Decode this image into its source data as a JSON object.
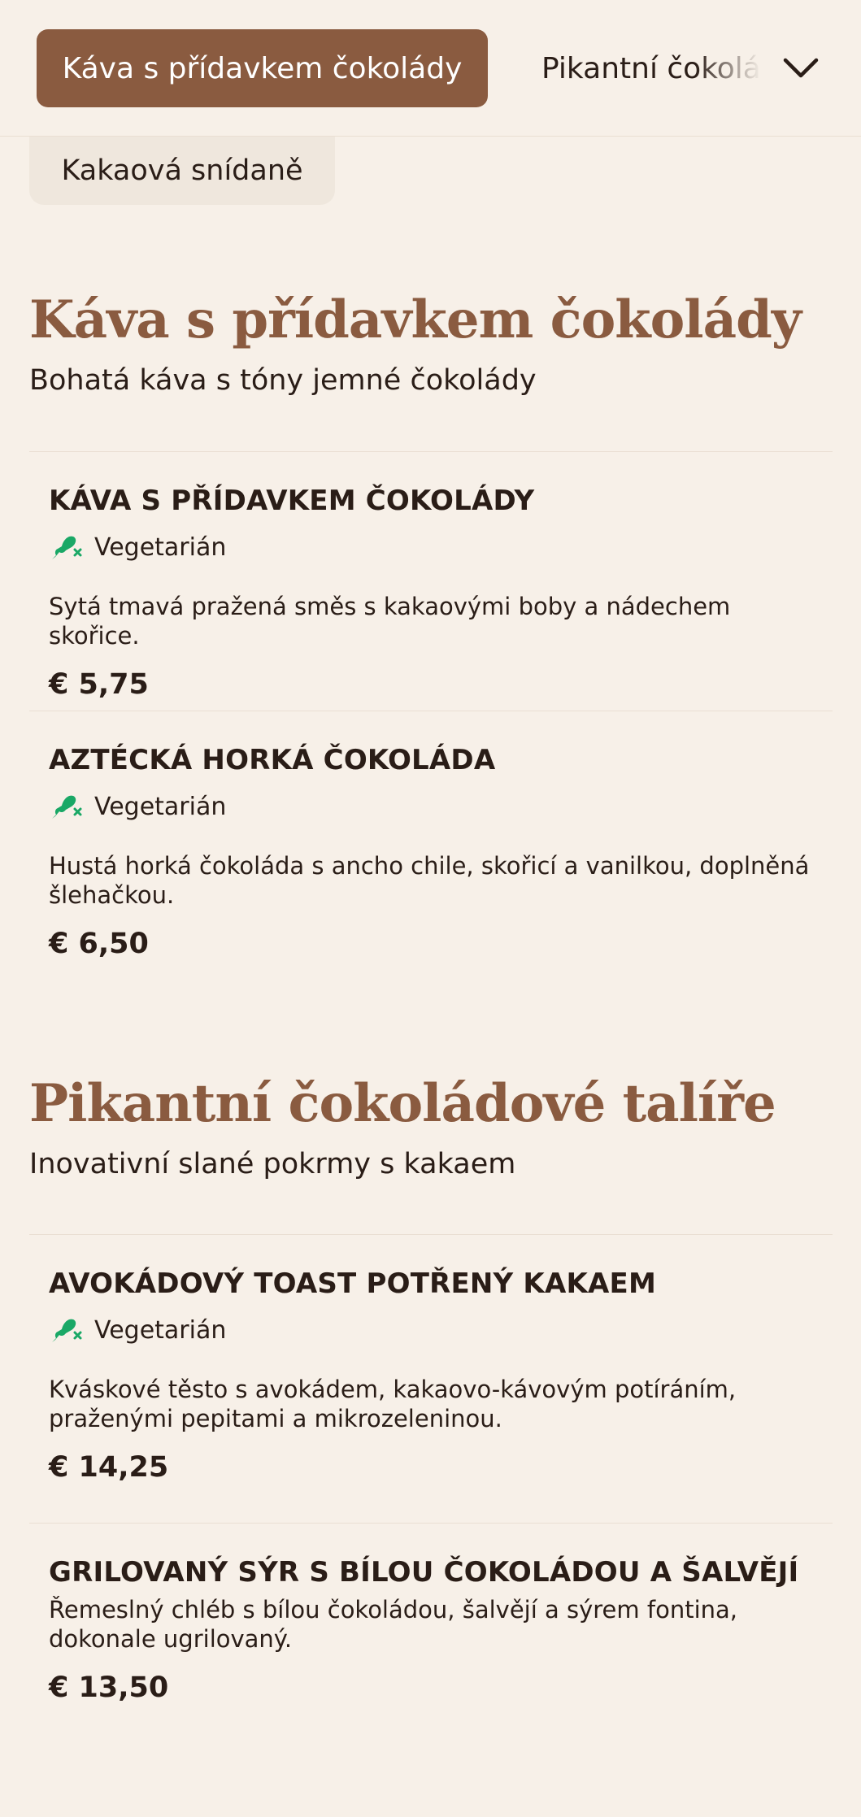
{
  "nav": {
    "active_tab": "Káva s přídavkem čokolády",
    "next_tab": "Pikantní čokoládové talíře",
    "second_row_tab": "Kakaová snídaně",
    "chevron_icon": "chevron-down-icon"
  },
  "colors": {
    "accent": "#8a5b40",
    "background": "#f7f0e8",
    "vegetarian_icon": "#1aa866"
  },
  "sections": [
    {
      "title": "Káva s přídavkem čokolády",
      "description": "Bohatá káva s tóny jemné čokolády",
      "items": [
        {
          "name": "KÁVA S PŘÍDAVKEM ČOKOLÁDY",
          "badge": "Vegetarián",
          "description": "Sytá tmavá pražená směs s kakaovými boby a nádechem skořice.",
          "price": "€ 5,75"
        },
        {
          "name": "AZTÉCKÁ HORKÁ ČOKOLÁDA",
          "badge": "Vegetarián",
          "description": "Hustá horká čokoláda s ancho chile, skořicí a vanilkou, doplněná šlehačkou.",
          "price": "€ 6,50"
        }
      ]
    },
    {
      "title": "Pikantní čokoládové talíře",
      "description": "Inovativní slané pokrmy s kakaem",
      "items": [
        {
          "name": "AVOKÁDOVÝ TOAST POTŘENÝ KAKAEM",
          "badge": "Vegetarián",
          "description": "Kváskové těsto s avokádem, kakaovo-kávovým potíráním, praženými pepitami a mikrozeleninou.",
          "price": "€ 14,25"
        },
        {
          "name": "GRILOVANÝ SÝR S BÍLOU ČOKOLÁDOU A ŠALVĚJÍ",
          "description": "Řemeslný chléb s bílou čokoládou, šalvějí a sýrem fontina, dokonale ugrilovaný.",
          "price": "€ 13,50"
        }
      ]
    }
  ]
}
